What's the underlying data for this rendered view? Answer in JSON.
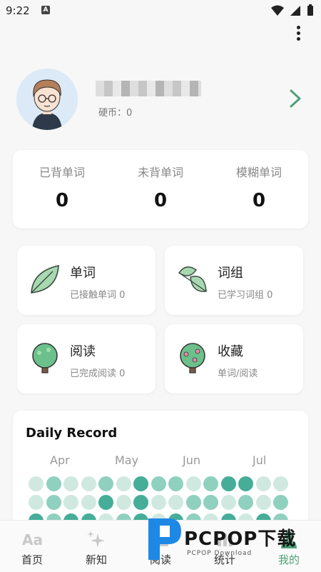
{
  "status_bar": {
    "time": "9:22",
    "notification_icon": "a-app-icon"
  },
  "profile": {
    "coins_label": "硬币：0"
  },
  "stats": [
    {
      "label": "已背单词",
      "value": "0"
    },
    {
      "label": "未背单词",
      "value": "0"
    },
    {
      "label": "模糊单词",
      "value": "0"
    }
  ],
  "tiles": [
    {
      "title": "单词",
      "sub": "已接触单词 0",
      "icon": "leaf-icon"
    },
    {
      "title": "词组",
      "sub": "已学习词组 0",
      "icon": "leaves-icon"
    },
    {
      "title": "阅读",
      "sub": "已完成阅读 0",
      "icon": "tree-icon"
    },
    {
      "title": "收藏",
      "sub": "单词/阅读",
      "icon": "fruit-tree-icon"
    }
  ],
  "daily_record": {
    "title": "Daily Record",
    "months": [
      "Apr",
      "May",
      "Jun",
      "Jul"
    ],
    "grid_levels": [
      [
        1,
        2,
        1,
        1,
        2,
        1,
        3,
        2,
        2,
        1,
        2,
        3,
        3,
        1,
        1
      ],
      [
        1,
        2,
        1,
        1,
        3,
        1,
        3,
        1,
        1,
        2,
        2,
        1,
        2,
        1,
        2
      ],
      [
        3,
        2,
        3,
        3,
        1,
        2,
        3,
        1,
        3,
        2,
        1,
        3,
        1,
        3,
        2
      ]
    ],
    "colors": [
      "#eef7f3",
      "#cfe9e0",
      "#8fd0bf",
      "#45ad98"
    ]
  },
  "bottom_nav": [
    {
      "label": "首页",
      "icon": "aa-icon"
    },
    {
      "label": "新知",
      "icon": "sparkle-icon"
    },
    {
      "label": "阅读",
      "icon": "book-icon"
    },
    {
      "label": "统计",
      "icon": "chart-icon"
    },
    {
      "label": "我的",
      "icon": "person-icon",
      "active": true
    }
  ],
  "watermark": {
    "text": "PCPOP下载",
    "sub": "PCPOP Download"
  },
  "accent_color": "#4fa07a"
}
